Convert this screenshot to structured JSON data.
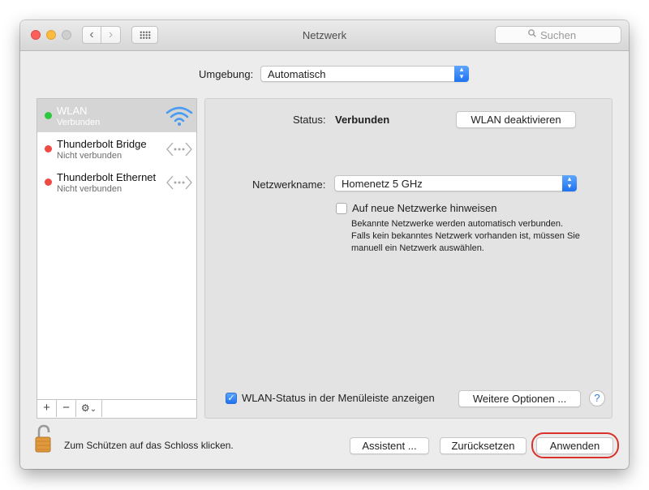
{
  "window": {
    "title": "Netzwerk",
    "search_placeholder": "Suchen",
    "nav_back": "‹",
    "nav_forward": "›"
  },
  "location": {
    "label": "Umgebung:",
    "value": "Automatisch"
  },
  "services": [
    {
      "name": "WLAN",
      "status": "Verbunden",
      "status_color": "#2ec840",
      "icon": "wifi-icon",
      "selected": true
    },
    {
      "name": "Thunderbolt Bridge",
      "status": "Nicht verbunden",
      "status_color": "#f04a45",
      "icon": "thunderbolt-arrows-icon",
      "selected": false
    },
    {
      "name": "Thunderbolt Ethernet",
      "status": "Nicht verbunden",
      "status_color": "#f04a45",
      "icon": "thunderbolt-arrows-icon",
      "selected": false
    }
  ],
  "sidebar_tools": {
    "add": "+",
    "remove": "−",
    "gear": "⚙",
    "chevron": "⌄"
  },
  "detail": {
    "status_label": "Status:",
    "status_value": "Verbunden",
    "toggle_button": "WLAN deaktivieren",
    "network_label": "Netzwerkname:",
    "network_value": "Homenetz 5 GHz",
    "ask_checkbox_label": "Auf neue Netzwerke hinweisen",
    "ask_checked": false,
    "info_line1": "Bekannte Netzwerke werden automatisch verbunden.",
    "info_line2": "Falls kein bekanntes Netzwerk vorhanden ist, müssen Sie",
    "info_line3": "manuell ein Netzwerk auswählen.",
    "menubar_checkbox_label": "WLAN-Status in der Menüleiste anzeigen",
    "menubar_checked": true,
    "advanced_button": "Weitere Optionen ...",
    "help": "?"
  },
  "footer": {
    "lock_text": "Zum Schützen auf das Schloss klicken.",
    "assistant_button": "Assistent ...",
    "revert_button": "Zurücksetzen",
    "apply_button": "Anwenden"
  },
  "colors": {
    "accent": "#1f72f0",
    "annotation": "#d9322b"
  }
}
